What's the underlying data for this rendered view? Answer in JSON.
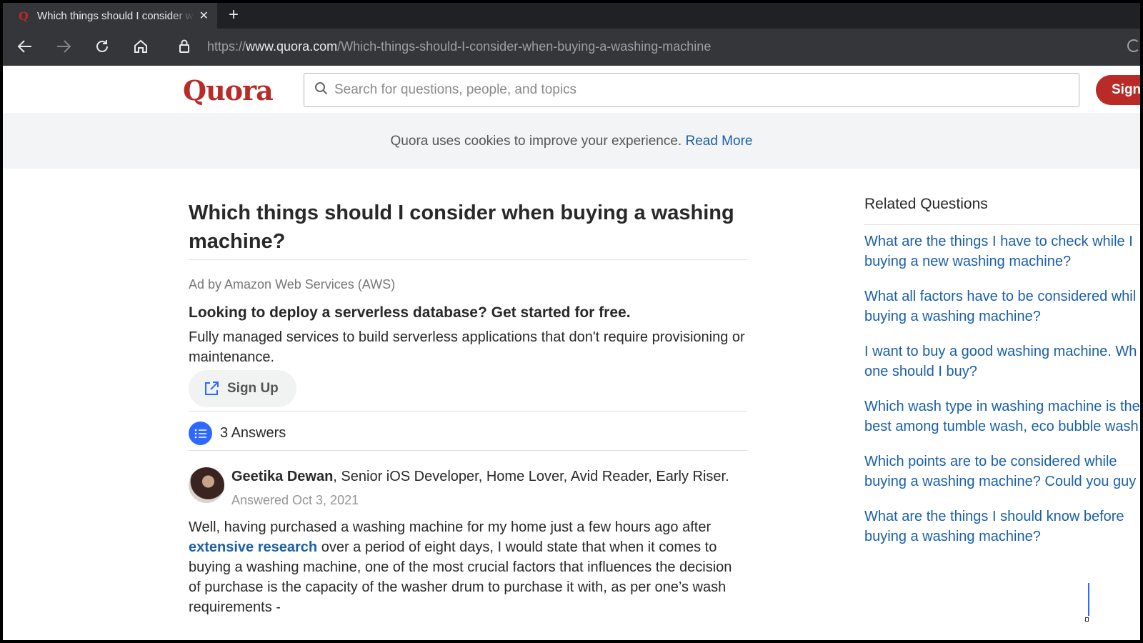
{
  "browser": {
    "tab_title": "Which things should I consider when buying a washing machine",
    "tab_favicon": "Q",
    "new_tab": "+",
    "url_scheme": "https://",
    "url_host": "www.quora.com",
    "url_path": "/Which-things-should-I-consider-when-buying-a-washing-machine"
  },
  "header": {
    "logo": "Quora",
    "search_placeholder": "Search for questions, people, and topics",
    "sign_in_label": "Sign"
  },
  "cookie_banner": {
    "text": "Quora uses cookies to improve your experience.",
    "link": "Read More"
  },
  "question": {
    "title": "Which things should I consider when buying a washing machine?"
  },
  "ad": {
    "by": "Ad by Amazon Web Services (AWS)",
    "headline": "Looking to deploy a serverless database? Get started for free.",
    "body": "Fully managed services to build serverless applications that don't require provisioning or maintenance.",
    "button": "Sign Up"
  },
  "answers": {
    "count_label": "3 Answers"
  },
  "answer": {
    "author_name": "Geetika Dewan",
    "author_credentials": ", Senior iOS Developer, Home Lover, Avid Reader, Early Riser.",
    "date": "Answered Oct 3, 2021",
    "text_before": "Well, having purchased a washing machine for my home just a few hours ago after ",
    "link_text": "extensive research",
    "text_after": " over a period of eight days, I would state that when it comes to buying a washing machine, one of the most crucial factors that influences the decision of purchase is the capacity of the washer drum to purchase it with, as per one’s wash requirements -"
  },
  "related": {
    "title": "Related Questions",
    "items": [
      "What are the things I have to check while I buying a new washing machine?",
      "What all factors have to be considered whil buying a washing machine?",
      "I want to buy a good washing machine. Wh one should I buy?",
      "Which wash type in washing machine is the best among tumble wash, eco bubble wash",
      "Which points are to be considered while buying a washing machine? Could you guy",
      "What are the things I should know before buying a washing machine?"
    ]
  },
  "colors": {
    "brand": "#b92b27",
    "link": "#195faa",
    "accent": "#2e69ff"
  }
}
